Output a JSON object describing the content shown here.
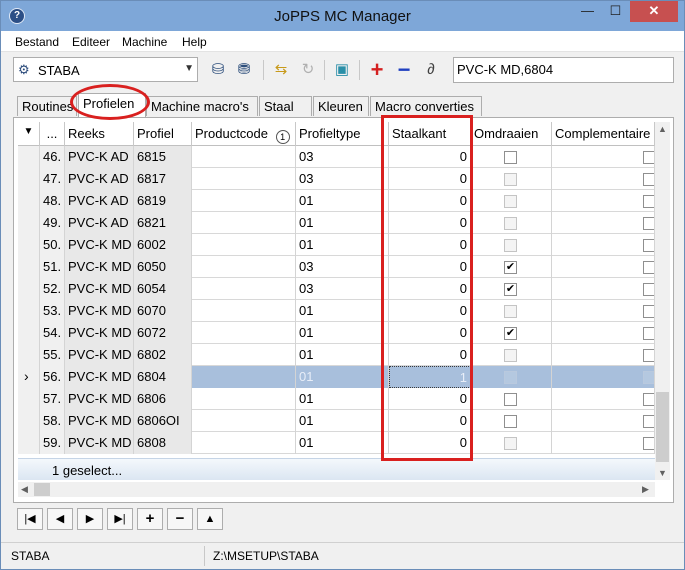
{
  "window": {
    "title": "JoPPS MC Manager",
    "app_icon": "?"
  },
  "title_buttons": {
    "minimize": "—",
    "maximize": "☐",
    "close": "✕"
  },
  "menu": [
    "Bestand",
    "Editeer",
    "Machine",
    "Help"
  ],
  "toolbar": {
    "machine_value": "STABA",
    "profile_value": "PVC-K MD,6804",
    "icons": [
      "db-export-icon",
      "db-import-icon",
      "import-icon",
      "refresh-icon",
      "package-icon",
      "add-icon",
      "remove-icon",
      "link-icon"
    ]
  },
  "tabs": [
    "Routines",
    "Profielen",
    "Machine macro's",
    "Staal",
    "Kleuren",
    "Macro converties"
  ],
  "active_tab": "Profielen",
  "grid": {
    "columns": [
      "...",
      "Reeks",
      "Profiel",
      "Productcode",
      "Profieltype",
      "Staalkant",
      "Omdraaien",
      "Complementaire"
    ],
    "rows": [
      {
        "num": "46.",
        "reeks": "PVC-K AD",
        "profiel": "6815",
        "productcode": "",
        "type": "03",
        "staalkant": "0",
        "omdraaien": false,
        "omdraaien_enabled": true
      },
      {
        "num": "47.",
        "reeks": "PVC-K AD",
        "profiel": "6817",
        "productcode": "",
        "type": "03",
        "staalkant": "0",
        "omdraaien": false,
        "omdraaien_enabled": false
      },
      {
        "num": "48.",
        "reeks": "PVC-K AD",
        "profiel": "6819",
        "productcode": "",
        "type": "01",
        "staalkant": "0",
        "omdraaien": false,
        "omdraaien_enabled": false
      },
      {
        "num": "49.",
        "reeks": "PVC-K AD",
        "profiel": "6821",
        "productcode": "",
        "type": "01",
        "staalkant": "0",
        "omdraaien": false,
        "omdraaien_enabled": false
      },
      {
        "num": "50.",
        "reeks": "PVC-K MD",
        "profiel": "6002",
        "productcode": "",
        "type": "01",
        "staalkant": "0",
        "omdraaien": false,
        "omdraaien_enabled": false
      },
      {
        "num": "51.",
        "reeks": "PVC-K MD",
        "profiel": "6050",
        "productcode": "",
        "type": "03",
        "staalkant": "0",
        "omdraaien": true,
        "omdraaien_enabled": true
      },
      {
        "num": "52.",
        "reeks": "PVC-K MD",
        "profiel": "6054",
        "productcode": "",
        "type": "03",
        "staalkant": "0",
        "omdraaien": true,
        "omdraaien_enabled": true
      },
      {
        "num": "53.",
        "reeks": "PVC-K MD",
        "profiel": "6070",
        "productcode": "",
        "type": "01",
        "staalkant": "0",
        "omdraaien": false,
        "omdraaien_enabled": false
      },
      {
        "num": "54.",
        "reeks": "PVC-K MD",
        "profiel": "6072",
        "productcode": "",
        "type": "01",
        "staalkant": "0",
        "omdraaien": true,
        "omdraaien_enabled": true
      },
      {
        "num": "55.",
        "reeks": "PVC-K MD",
        "profiel": "6802",
        "productcode": "",
        "type": "01",
        "staalkant": "0",
        "omdraaien": false,
        "omdraaien_enabled": false
      },
      {
        "num": "56.",
        "reeks": "PVC-K MD",
        "profiel": "6804",
        "productcode": "",
        "type": "01",
        "staalkant": "1",
        "omdraaien": false,
        "omdraaien_enabled": false,
        "selected": true
      },
      {
        "num": "57.",
        "reeks": "PVC-K MD",
        "profiel": "6806",
        "productcode": "",
        "type": "01",
        "staalkant": "0",
        "omdraaien": false,
        "omdraaien_enabled": true
      },
      {
        "num": "58.",
        "reeks": "PVC-K MD",
        "profiel": "6806OI",
        "productcode": "",
        "type": "01",
        "staalkant": "0",
        "omdraaien": false,
        "omdraaien_enabled": true
      },
      {
        "num": "59.",
        "reeks": "PVC-K MD",
        "profiel": "6808",
        "productcode": "",
        "type": "01",
        "staalkant": "0",
        "omdraaien": false,
        "omdraaien_enabled": false
      }
    ],
    "footer": "1 geselect...",
    "row_indicator": "›",
    "header_sort_icon": "▼",
    "productcode_info": "1"
  },
  "navigator": [
    "|◀",
    "◀",
    "▶",
    "▶|",
    "+",
    "−",
    "▲"
  ],
  "status": {
    "machine": "STABA",
    "path": "Z:\\MSETUP\\STABA"
  },
  "colors": {
    "annotation": "#d9201f",
    "selection": "#a8bfdc"
  }
}
